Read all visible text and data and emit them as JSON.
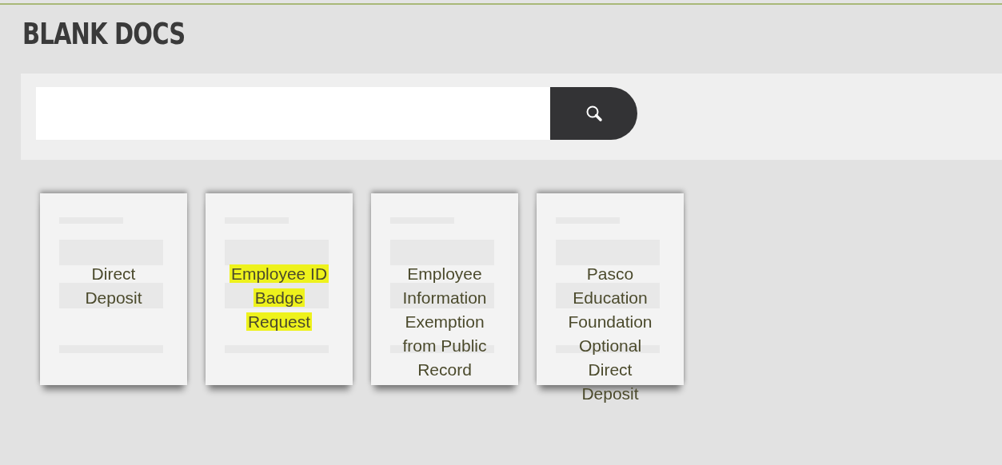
{
  "page": {
    "title": "BLANK DOCS"
  },
  "documents": [
    {
      "title": "Direct Deposit",
      "highlighted": false
    },
    {
      "title": "Employee ID Badge Request",
      "highlighted": true
    },
    {
      "title": "Employee Information Exemption from Public Record",
      "highlighted": false
    },
    {
      "title": "Pasco Education Foundation Optional Direct Deposit",
      "highlighted": false
    }
  ]
}
